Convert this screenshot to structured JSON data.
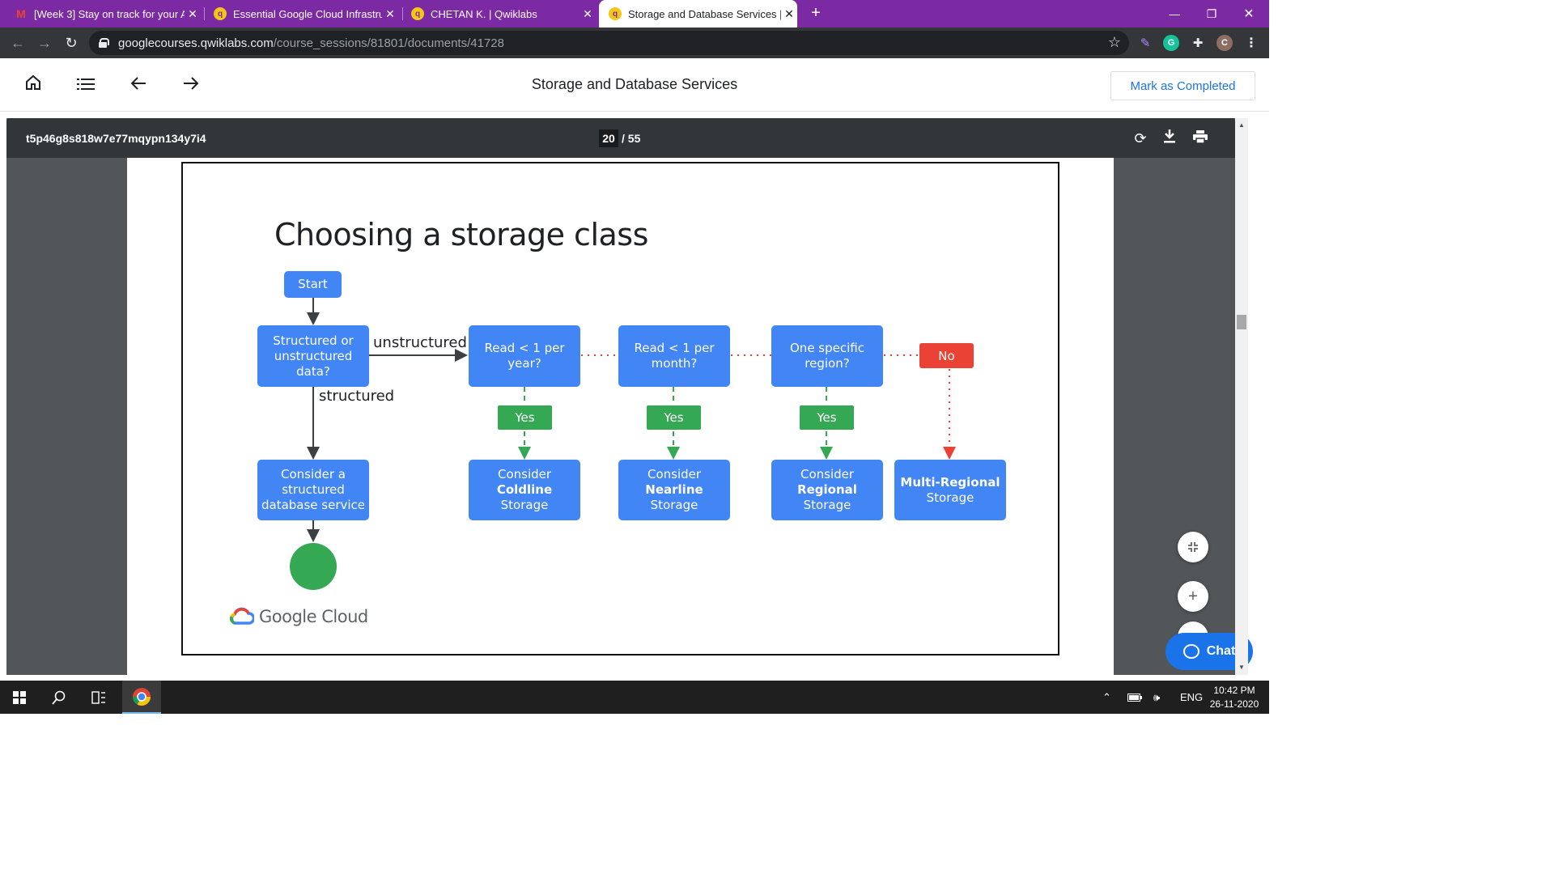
{
  "browser": {
    "tabs": [
      {
        "title": "[Week 3] Stay on track for your A",
        "favicon": "gmail-icon",
        "active": false
      },
      {
        "title": "Essential Google Cloud Infrastruc",
        "favicon": "qwiklabs-icon",
        "active": false
      },
      {
        "title": "CHETAN K. | Qwiklabs",
        "favicon": "qwiklabs-icon",
        "active": false
      },
      {
        "title": "Storage and Database Services | (",
        "favicon": "qwiklabs-icon",
        "active": true
      }
    ],
    "url_host": "googlecourses.qwiklabs.com",
    "url_path": "/course_sessions/81801/documents/41728",
    "profile_initial": "C",
    "extension_initial": "G"
  },
  "app": {
    "title": "Storage and Database Services",
    "mark_completed_label": "Mark as Completed"
  },
  "pdf": {
    "filename": "t5p46g8s818w7e77mqypn134y7i4",
    "current_page": "20",
    "total_pages": "/ 55"
  },
  "slide": {
    "title": "Choosing a storage class",
    "start": "Start",
    "decision_main": "Structured or unstructured data?",
    "label_unstructured": "unstructured",
    "label_structured": "structured",
    "structured_result": "Consider a structured database service",
    "q1": "Read < 1 per year?",
    "q2": "Read < 1 per month?",
    "q3": "One specific region?",
    "yes": "Yes",
    "no": "No",
    "r1_prefix": "Consider ",
    "r1_bold": "Coldline",
    "r1_suffix": "Storage",
    "r2_prefix": "Consider ",
    "r2_bold": "Nearline",
    "r2_suffix": "Storage",
    "r3_prefix": "Consider ",
    "r3_bold": "Regional",
    "r3_suffix": "Storage",
    "r4_bold": "Multi-Regional",
    "r4_suffix": "Storage",
    "brand": "Google Cloud",
    "colors": {
      "blue": "#4285f4",
      "green": "#34a853",
      "red": "#ea4335"
    }
  },
  "chat": {
    "label": "Chat"
  },
  "taskbar": {
    "language": "ENG",
    "time": "10:42 PM",
    "date": "26-11-2020"
  }
}
